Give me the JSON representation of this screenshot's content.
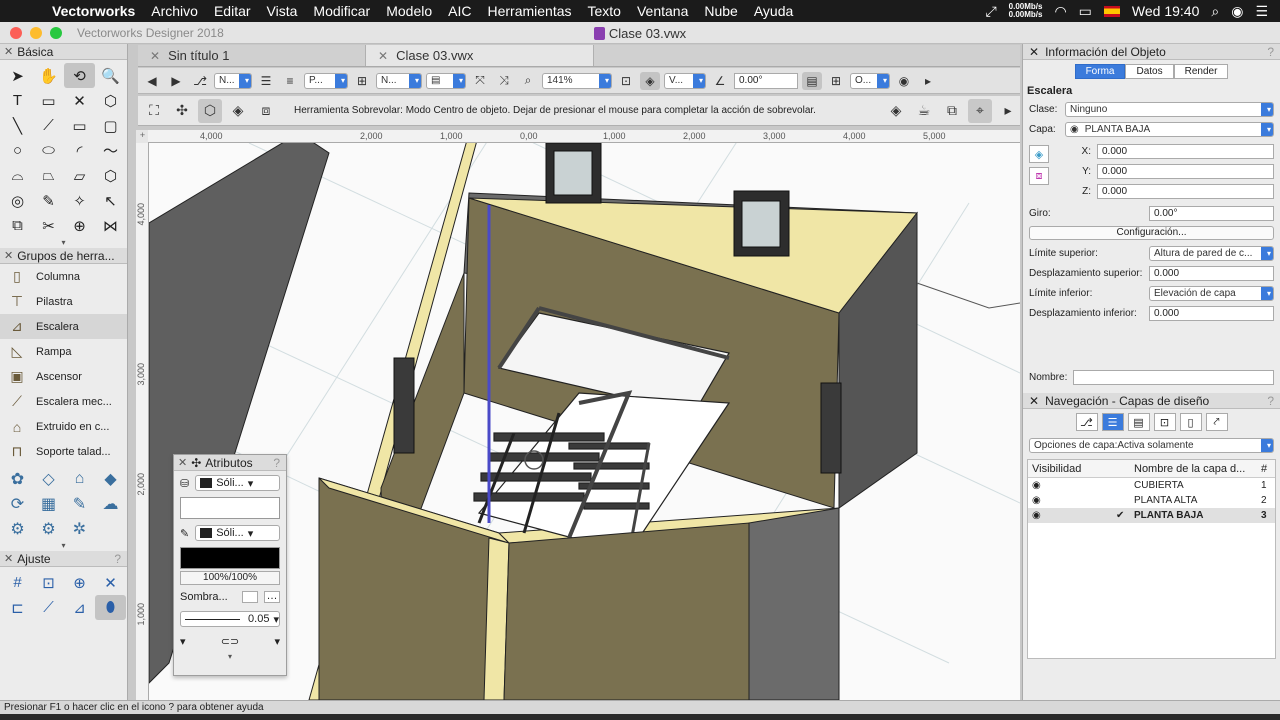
{
  "menubar": {
    "app": "Vectorworks",
    "items": [
      "Archivo",
      "Editar",
      "Vista",
      "Modificar",
      "Modelo",
      "AIC",
      "Herramientas",
      "Texto",
      "Ventana",
      "Nube",
      "Ayuda"
    ],
    "net_up": "0.00Mb/s",
    "net_down": "0.00Mb/s",
    "clock": "Wed 19:40"
  },
  "titlebar": {
    "app_title": "Vectorworks Designer 2018",
    "window_title": "Clase 03.vwx"
  },
  "tool_palette": {
    "title": "Básica",
    "tools": [
      {
        "icon": "arrow-select-icon",
        "glyph": "➤"
      },
      {
        "icon": "pan-hand-icon",
        "glyph": "✋"
      },
      {
        "icon": "flyover-icon",
        "glyph": "⟲"
      },
      {
        "icon": "zoom-icon",
        "glyph": "🔍"
      },
      {
        "icon": "text-tool-icon",
        "glyph": "T"
      },
      {
        "icon": "callout-icon",
        "glyph": "▭"
      },
      {
        "icon": "locus-icon",
        "glyph": "✕"
      },
      {
        "icon": "3d-locus-icon",
        "glyph": "⬡"
      },
      {
        "icon": "line-icon",
        "glyph": "╲"
      },
      {
        "icon": "double-line-icon",
        "glyph": "⟋"
      },
      {
        "icon": "rectangle-icon",
        "glyph": "▭"
      },
      {
        "icon": "rounded-rect-icon",
        "glyph": "▢"
      },
      {
        "icon": "circle-icon",
        "glyph": "○"
      },
      {
        "icon": "oval-icon",
        "glyph": "⬭"
      },
      {
        "icon": "arc-icon",
        "glyph": "◜"
      },
      {
        "icon": "freehand-icon",
        "glyph": "〜"
      },
      {
        "icon": "polyline-icon",
        "glyph": "⌓"
      },
      {
        "icon": "polygon-icon",
        "glyph": "⏢"
      },
      {
        "icon": "double-polyline-icon",
        "glyph": "⏥"
      },
      {
        "icon": "regular-polygon-icon",
        "glyph": "⬡"
      },
      {
        "icon": "spiral-icon",
        "glyph": "◎"
      },
      {
        "icon": "eyedropper-icon",
        "glyph": "✎"
      },
      {
        "icon": "magic-wand-icon",
        "glyph": "✧"
      },
      {
        "icon": "select-similar-icon",
        "glyph": "↖"
      },
      {
        "icon": "offset-icon",
        "glyph": "⧉"
      },
      {
        "icon": "trim-icon",
        "glyph": "✂"
      },
      {
        "icon": "rotate-icon",
        "glyph": "⊕"
      },
      {
        "icon": "mirror-icon",
        "glyph": "⋈"
      }
    ]
  },
  "tool_sets": {
    "title": "Grupos de herra...",
    "items": [
      {
        "label": "Columna",
        "icon": "column-icon",
        "glyph": "▯"
      },
      {
        "label": "Pilastra",
        "icon": "pilaster-icon",
        "glyph": "⊤"
      },
      {
        "label": "Escalera",
        "icon": "stair-icon",
        "glyph": "⊿"
      },
      {
        "label": "Rampa",
        "icon": "ramp-icon",
        "glyph": "◺"
      },
      {
        "label": "Ascensor",
        "icon": "elevator-icon",
        "glyph": "▣"
      },
      {
        "label": "Escalera mec...",
        "icon": "escalator-icon",
        "glyph": "⟋"
      },
      {
        "label": "Extruido en c...",
        "icon": "extrude-icon",
        "glyph": "⌂"
      },
      {
        "label": "Soporte talad...",
        "icon": "support-icon",
        "glyph": "⊓"
      }
    ],
    "set_icons": [
      {
        "icon": "site-icon",
        "glyph": "✿"
      },
      {
        "icon": "slab-icon",
        "glyph": "◇"
      },
      {
        "icon": "building-icon",
        "glyph": "⌂"
      },
      {
        "icon": "visualization-icon",
        "glyph": "◆"
      },
      {
        "icon": "dimension-icon",
        "glyph": "⟳"
      },
      {
        "icon": "furniture-icon",
        "glyph": "▦"
      },
      {
        "icon": "detailing-icon",
        "glyph": "✎"
      },
      {
        "icon": "landscape-icon",
        "glyph": "☁"
      },
      {
        "icon": "machine-icon",
        "glyph": "⚙"
      },
      {
        "icon": "mep-icon",
        "glyph": "⚙"
      },
      {
        "icon": "settings-gear-icon",
        "glyph": "✲"
      }
    ]
  },
  "snap_palette": {
    "title": "Ajuste",
    "snaps": [
      {
        "icon": "snap-grid-icon",
        "glyph": "#"
      },
      {
        "icon": "snap-object-icon",
        "glyph": "⊡"
      },
      {
        "icon": "snap-angle-icon",
        "glyph": "⊕"
      },
      {
        "icon": "snap-intersection-icon",
        "glyph": "✕"
      },
      {
        "icon": "snap-distance-icon",
        "glyph": "⊏"
      },
      {
        "icon": "snap-tangent-icon",
        "glyph": "⟋"
      },
      {
        "icon": "snap-point-icon",
        "glyph": "⊿"
      },
      {
        "icon": "snap-smart-icon",
        "glyph": "⬮"
      }
    ]
  },
  "doc_tabs": [
    {
      "label": "Sin título 1",
      "active": false
    },
    {
      "label": "Clase 03.vwx",
      "active": true
    }
  ],
  "view_bar": {
    "class_dd": "N...",
    "layer_dd": "P...",
    "view_dd": "N...",
    "zoom": "141%",
    "render_dd": "V...",
    "angle": "0.00°",
    "other_dd": "O..."
  },
  "mode_bar": {
    "help_text": "Herramienta Sobrevolar: Modo Centro de objeto. Dejar de presionar el mouse para completar la acción de sobrevolar."
  },
  "rulers": {
    "h": [
      "4,000",
      "2,000",
      "1,000",
      "0,00",
      "1,000",
      "2,000",
      "3,000",
      "4,000",
      "5,000"
    ],
    "v": [
      "4,000",
      "3,000",
      "2,000",
      "1,000"
    ]
  },
  "attributes": {
    "title": "Atributos",
    "fill_label": "Sóli...",
    "pen_label": "Sóli...",
    "fill_color": "#ffffff",
    "pen_color": "#000000",
    "opacity": "100%/100%",
    "shadow_label": "Sombra...",
    "line_weight": "0.05"
  },
  "obj_info": {
    "title": "Información del Objeto",
    "tabs": [
      {
        "label": "Forma",
        "active": true
      },
      {
        "label": "Datos",
        "active": false
      },
      {
        "label": "Render",
        "active": false
      }
    ],
    "type": "Escalera",
    "class_label": "Clase:",
    "class_value": "Ninguno",
    "layer_label": "Capa:",
    "layer_value": "PLANTA BAJA",
    "x_label": "X:",
    "x": "0.000",
    "y_label": "Y:",
    "y": "0.000",
    "z_label": "Z:",
    "z": "0.000",
    "rotation_label": "Giro:",
    "rotation": "0.00°",
    "config_button": "Configuración...",
    "top_limit_label": "Límite superior:",
    "top_limit": "Altura de pared de c...",
    "top_offset_label": "Desplazamiento superior:",
    "top_offset": "0.000",
    "bottom_limit_label": "Límite inferior:",
    "bottom_limit": "Elevación de capa",
    "bottom_offset_label": "Desplazamiento inferior:",
    "bottom_offset": "0.000",
    "name_label": "Nombre:"
  },
  "navigation": {
    "title": "Navegación - Capas de diseño",
    "options_label": "Opciones de capa:",
    "options_value": "Activa solamente",
    "col_visibility": "Visibilidad",
    "col_name": "Nombre de la capa d...",
    "col_num": "#",
    "layers": [
      {
        "name": "CUBIERTA",
        "num": "1",
        "active": false
      },
      {
        "name": "PLANTA ALTA",
        "num": "2",
        "active": false
      },
      {
        "name": "PLANTA BAJA",
        "num": "3",
        "active": true
      }
    ],
    "active_check": "✔"
  },
  "statusbar": {
    "text": "Presionar F1 o hacer clic en el icono ? para obtener ayuda"
  },
  "colors": {
    "wall_face": "#7a7150",
    "wall_top": "#f0e6a6",
    "wall_dark": "#5c5c5c",
    "accent": "#3b7bdc",
    "floor": "#ffffff"
  }
}
